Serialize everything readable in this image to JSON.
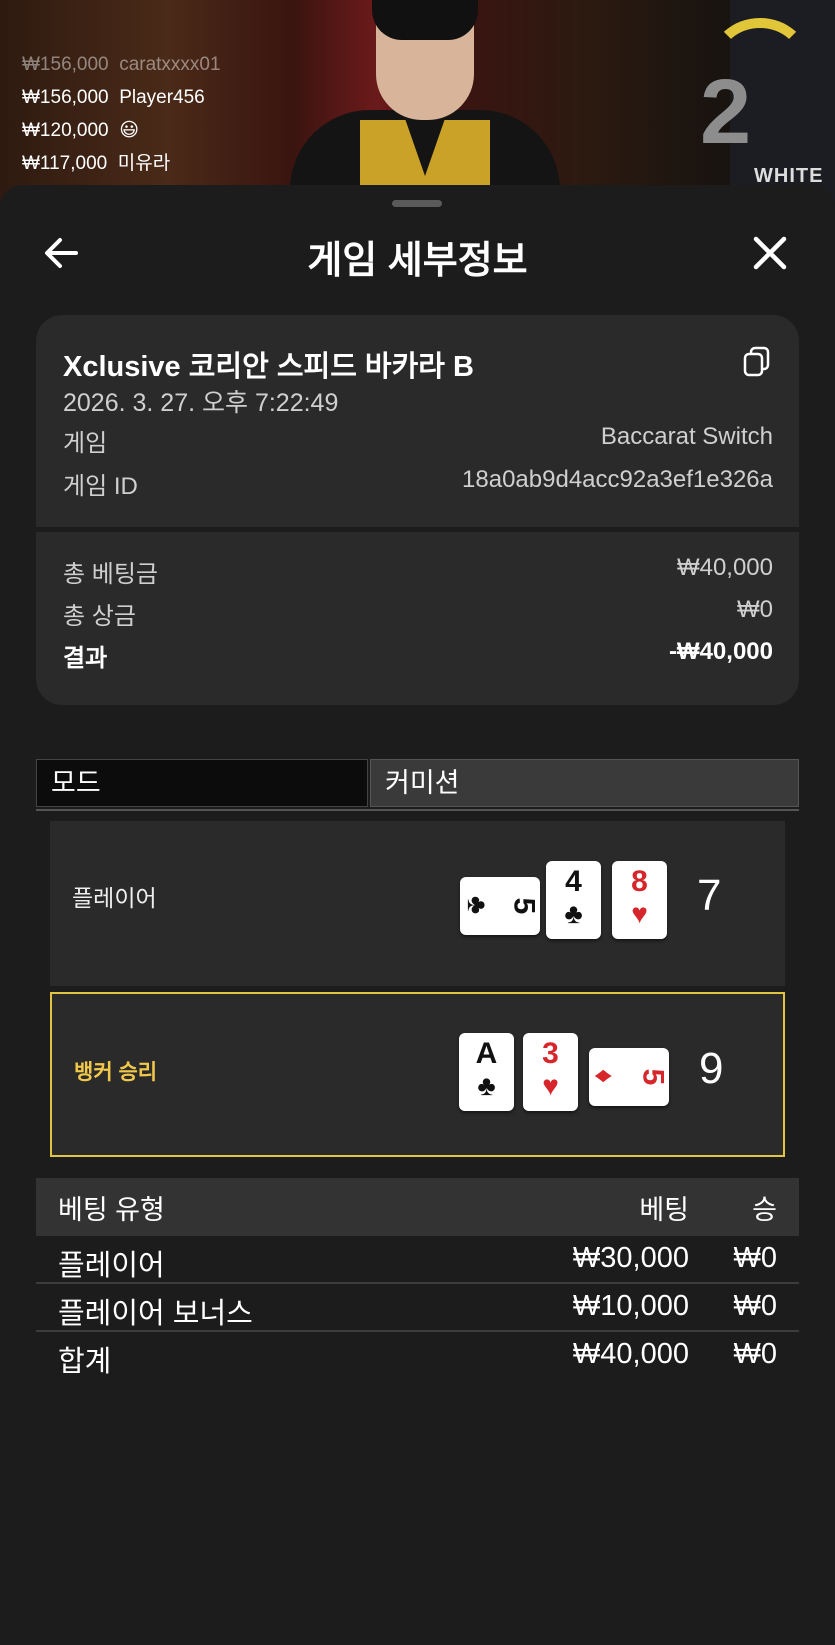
{
  "chat": [
    {
      "amount": "₩156,000",
      "name": "caratxxxx01"
    },
    {
      "amount": "₩156,000",
      "name": "Player456"
    },
    {
      "amount": "₩120,000",
      "name": "😃"
    },
    {
      "amount": "₩117,000",
      "name": "미유라"
    }
  ],
  "stream": {
    "round_number": "2",
    "brand": "WHITE"
  },
  "header": {
    "title": "게임 세부정보",
    "back_icon": "arrow-left-icon",
    "close_icon": "close-icon"
  },
  "summary": {
    "game_name": "Xclusive 코리안 스피드 바카라 B",
    "datetime": "2026. 3. 27. 오후 7:22:49",
    "game_label": "게임",
    "game_value": "Baccarat Switch",
    "id_label": "게임 ID",
    "id_value": "18a0ab9d4acc92a3ef1e326a",
    "total_bet_label": "총 베팅금",
    "total_bet_value": "₩40,000",
    "total_win_label": "총 상금",
    "total_win_value": "₩0",
    "result_label": "결과",
    "result_value": "-₩40,000"
  },
  "tabs": {
    "mode": "모드",
    "commission": "커미션"
  },
  "hands": {
    "player": {
      "label": "플레이어",
      "score": "7",
      "cards": [
        {
          "rank": "5",
          "suit": "♣",
          "color": "black",
          "orientation": "sideways"
        },
        {
          "rank": "4",
          "suit": "♣",
          "color": "black",
          "orientation": "upright"
        },
        {
          "rank": "8",
          "suit": "♥",
          "color": "red",
          "orientation": "upright"
        }
      ]
    },
    "banker": {
      "label": "뱅커 승리",
      "score": "9",
      "cards": [
        {
          "rank": "A",
          "suit": "♣",
          "color": "black",
          "orientation": "upright"
        },
        {
          "rank": "3",
          "suit": "♥",
          "color": "red",
          "orientation": "upright"
        },
        {
          "rank": "5",
          "suit": "♦",
          "color": "red",
          "orientation": "sideways"
        }
      ]
    }
  },
  "bets": {
    "headers": {
      "type": "베팅 유형",
      "bet": "베팅",
      "win": "승"
    },
    "rows": [
      {
        "type": "플레이어",
        "bet": "₩30,000",
        "win": "₩0"
      },
      {
        "type": "플레이어 보너스",
        "bet": "₩10,000",
        "win": "₩0"
      },
      {
        "type": "합계",
        "bet": "₩40,000",
        "win": "₩0"
      }
    ]
  },
  "colors": {
    "highlight": "#e2c342",
    "card_red": "#d7262b"
  }
}
